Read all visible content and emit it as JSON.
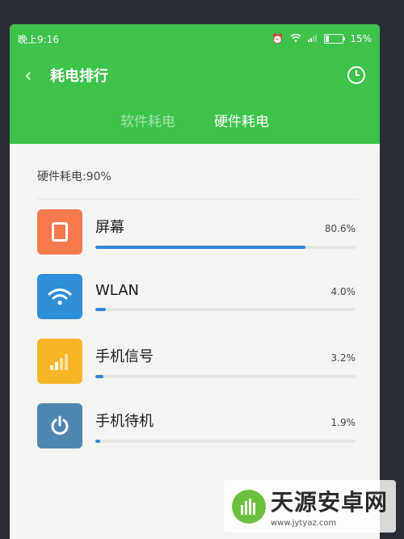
{
  "statusbar": {
    "time": "晚上9:16",
    "battery_text": "15%"
  },
  "toolbar": {
    "title": "耗电排行"
  },
  "tabs": [
    {
      "label": "软件耗电"
    },
    {
      "label": "硬件耗电"
    }
  ],
  "summary": "硬件耗电:90%",
  "items": [
    {
      "name": "屏幕",
      "percent": "80.6%",
      "bar_fraction": 0.806,
      "icon": "screen-icon",
      "color": "#f47a4d"
    },
    {
      "name": "WLAN",
      "percent": "4.0%",
      "bar_fraction": 0.04,
      "icon": "wifi-icon",
      "color": "#2f8ed8"
    },
    {
      "name": "手机信号",
      "percent": "3.2%",
      "bar_fraction": 0.032,
      "icon": "signal-icon",
      "color": "#f5b525"
    },
    {
      "name": "手机待机",
      "percent": "1.9%",
      "bar_fraction": 0.019,
      "icon": "power-icon",
      "color": "#4f86b0"
    }
  ],
  "colors": {
    "header_green": "#3ec24a",
    "bar_blue": "#2f86d8",
    "track_gray": "#e4e4e2"
  },
  "watermark": {
    "main": "天源安卓网",
    "sub": "www.jytyaz.com"
  }
}
